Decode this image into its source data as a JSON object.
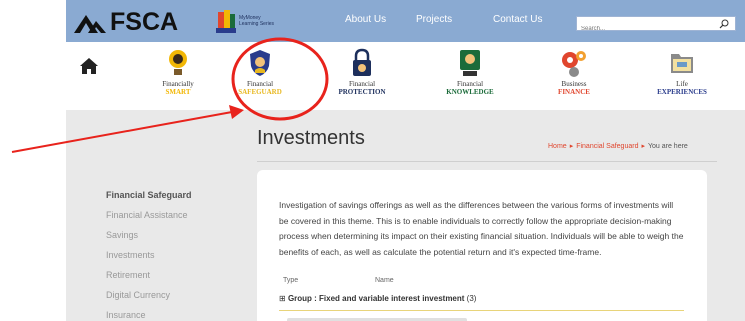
{
  "header": {
    "logo_text": "FSCA",
    "mymoney_line1": "MyMoney",
    "mymoney_line2": "Learning Series",
    "nav": [
      {
        "label": "About Us"
      },
      {
        "label": "Projects"
      },
      {
        "label": "Contact Us"
      }
    ],
    "search_placeholder": "Search..."
  },
  "categories": [
    {
      "line1": "Financially",
      "line2": "SMART",
      "color": "#f2b705",
      "icon": "smart-icon"
    },
    {
      "line1": "Financial",
      "line2": "SAFEGUARD",
      "color": "#e8b820",
      "icon": "shield-icon"
    },
    {
      "line1": "Financial",
      "line2": "PROTECTION",
      "color": "#1d2f5c",
      "icon": "padlock-icon"
    },
    {
      "line1": "Financial",
      "line2": "KNOWLEDGE",
      "color": "#1b6b3a",
      "icon": "knowledge-icon"
    },
    {
      "line1": "Business",
      "line2": "FINANCE",
      "color": "#e0462e",
      "icon": "gears-icon"
    },
    {
      "line1": "Life",
      "line2": "EXPERIENCES",
      "color": "#2a3c8c",
      "icon": "folder-icon"
    }
  ],
  "main": {
    "title": "Investments",
    "breadcrumb": {
      "home": "Home",
      "parent": "Financial Safeguard",
      "current": "You are here"
    },
    "description": "Investigation of savings offerings as well as the differences between the various forms of investments will be covered in this theme. This is to enable individuals to correctly follow the appropriate decision-making process when determining its impact on their existing financial situation. Individuals will be able to weigh the benefits of each, as well as calculate the potential return and it's expected time-frame.",
    "table_headers": {
      "type": "Type",
      "name": "Name"
    },
    "group": {
      "prefix": "Group : ",
      "name": "Fixed and variable interest investment",
      "count": "(3)"
    }
  },
  "sidebar": {
    "items": [
      {
        "label": "Financial Safeguard"
      },
      {
        "label": "Financial Assistance"
      },
      {
        "label": "Savings"
      },
      {
        "label": "Investments"
      },
      {
        "label": "Retirement"
      },
      {
        "label": "Digital Currency"
      },
      {
        "label": "Insurance"
      }
    ]
  },
  "colors": {
    "header_bg": "#8aaad2",
    "accent_red": "#e0462e",
    "annotation_red": "#e8231c"
  }
}
